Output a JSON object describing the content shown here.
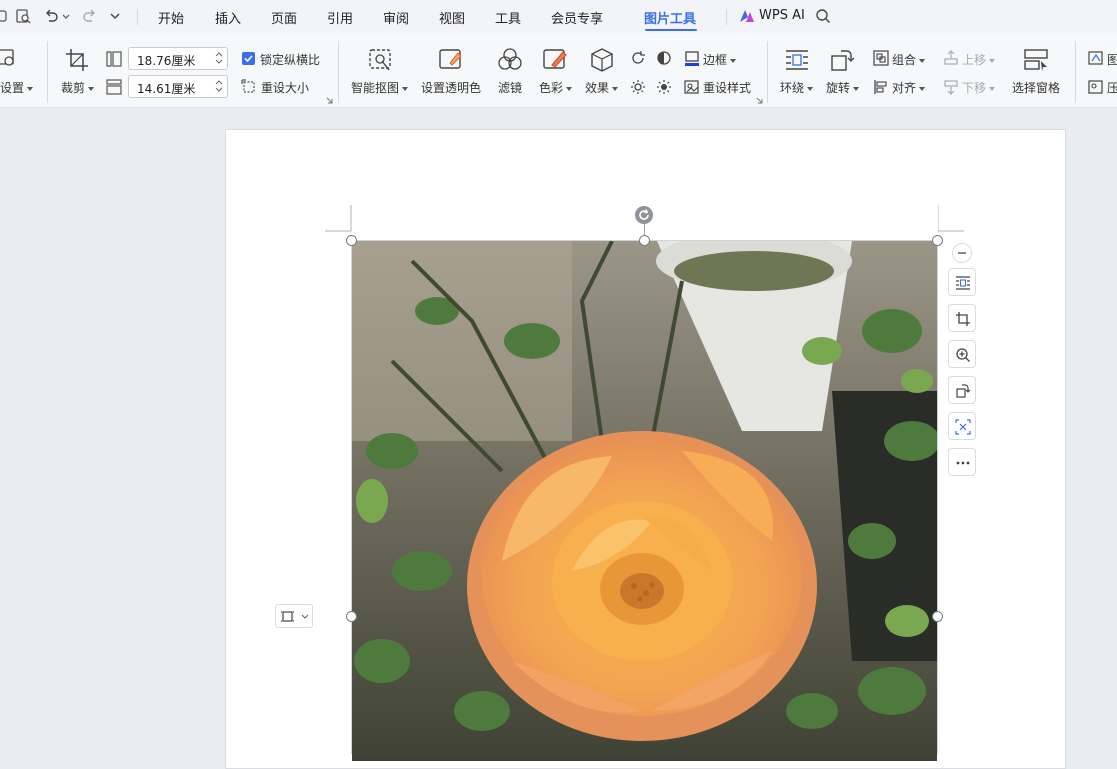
{
  "menubar": {
    "tabs": [
      "开始",
      "插入",
      "页面",
      "引用",
      "审阅",
      "视图",
      "工具",
      "会员专享",
      "图片工具"
    ],
    "active_tab": "图片工具",
    "wps_ai": "WPS AI"
  },
  "ribbon": {
    "settings": "设置",
    "crop": "裁剪",
    "width_value": "18.76厘米",
    "height_value": "14.61厘米",
    "lock_ratio": "锁定纵横比",
    "reset_size": "重设大小",
    "smart_cutout": "智能抠图",
    "set_transparent": "设置透明色",
    "filter": "滤镜",
    "color": "色彩",
    "effects": "效果",
    "border": "边框",
    "reset_style": "重设样式",
    "wrap": "环绕",
    "rotate": "旋转",
    "group": "组合",
    "align": "对齐",
    "bring_forward": "上移",
    "send_backward": "下移",
    "selection_pane": "选择窗格",
    "edge_top": "图",
    "edge_bottom": "压"
  },
  "colors": {
    "accent": "#3b6ee8",
    "ribbon_bg": "#f7f8fa",
    "canvas_bg": "#e9edf2",
    "border_line": "#1f3fd6"
  },
  "image": {
    "subject": "orange rose photo"
  }
}
